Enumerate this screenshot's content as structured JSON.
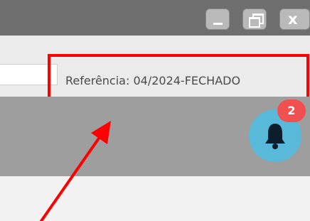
{
  "window": {
    "minimize_icon": "minimize-icon",
    "restore_icon": "restore-icon",
    "close_label": "x"
  },
  "header": {
    "reference_label": "Referência: 04/2024-FECHADO"
  },
  "notifications": {
    "icon": "bell-icon",
    "count": "2",
    "badge_color": "#f0504f",
    "bell_background": "#58b9d8"
  },
  "annotation": {
    "highlight_color": "#ff0000"
  }
}
